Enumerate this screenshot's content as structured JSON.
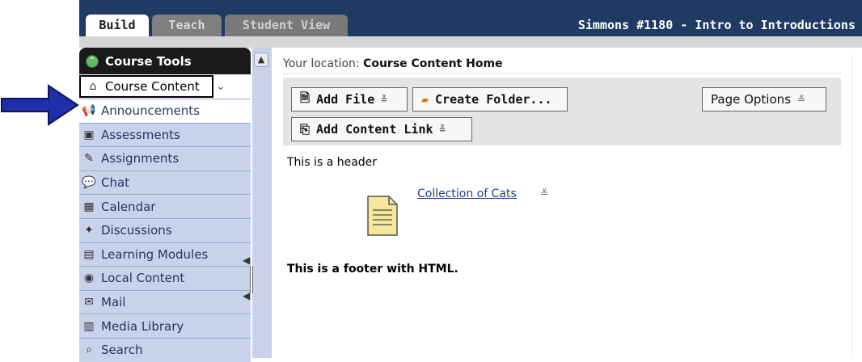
{
  "tabs": [
    {
      "label": "Build",
      "active": true
    },
    {
      "label": "Teach",
      "active": false
    },
    {
      "label": "Student View",
      "active": false
    }
  ],
  "course_title": "Simmons #1180 - Intro to Introductions",
  "sidebar": {
    "header": "Course Tools",
    "course_content_label": "Course Content",
    "items": [
      {
        "label": "Announcements",
        "icon": "megaphone-icon",
        "selected": true
      },
      {
        "label": "Assessments",
        "icon": "assessment-icon"
      },
      {
        "label": "Assignments",
        "icon": "assignment-icon"
      },
      {
        "label": "Chat",
        "icon": "chat-icon"
      },
      {
        "label": "Calendar",
        "icon": "calendar-icon"
      },
      {
        "label": "Discussions",
        "icon": "discussion-pin-icon"
      },
      {
        "label": "Learning Modules",
        "icon": "learning-modules-icon"
      },
      {
        "label": "Local Content",
        "icon": "local-content-icon"
      },
      {
        "label": "Mail",
        "icon": "mail-icon"
      },
      {
        "label": "Media Library",
        "icon": "media-library-icon"
      },
      {
        "label": "Search",
        "icon": "search-icon"
      }
    ]
  },
  "location": {
    "prefix": "Your location:",
    "value": "Course Content Home"
  },
  "toolbar": {
    "add_file": "Add File",
    "create_folder": "Create Folder...",
    "page_options": "Page Options",
    "add_content_link": "Add Content Link"
  },
  "content": {
    "header": "This is a header",
    "link": "Collection of Cats",
    "footer": "This is a footer with HTML."
  },
  "colors": {
    "topbar": "#1f3a63",
    "sidebar_item": "#c8d2eb",
    "arrow": "#1f2fa8"
  }
}
